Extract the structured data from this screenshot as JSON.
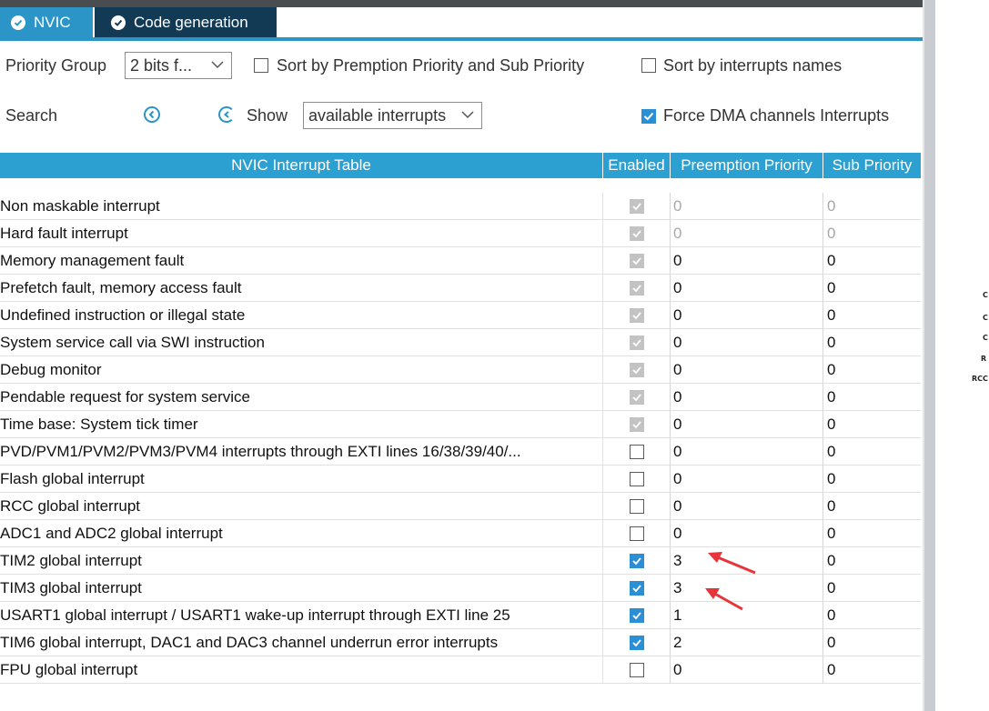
{
  "tabs": [
    {
      "label": "NVIC"
    },
    {
      "label": "Code generation"
    }
  ],
  "controls": {
    "priority_group_label": "Priority Group",
    "priority_group_value": "2 bits f...",
    "sort_priority_label": "Sort by Premption Priority and Sub Priority",
    "sort_names_label": "Sort by interrupts names",
    "search_label": "Search",
    "show_label": "Show",
    "show_value": "available interrupts",
    "force_dma_label": "Force DMA channels Interrupts",
    "force_dma_checked": true
  },
  "table": {
    "headers": [
      "NVIC Interrupt Table",
      "Enabled",
      "Preemption Priority",
      "Sub Priority"
    ],
    "rows": [
      {
        "name": "Non maskable interrupt",
        "enabled": "locked",
        "pre": "0",
        "sub": "0",
        "disabled": true
      },
      {
        "name": "Hard fault interrupt",
        "enabled": "locked",
        "pre": "0",
        "sub": "0",
        "disabled": true
      },
      {
        "name": "Memory management fault",
        "enabled": "locked",
        "pre": "0",
        "sub": "0",
        "disabled": false
      },
      {
        "name": "Prefetch fault, memory access fault",
        "enabled": "locked",
        "pre": "0",
        "sub": "0",
        "disabled": false
      },
      {
        "name": "Undefined instruction or illegal state",
        "enabled": "locked",
        "pre": "0",
        "sub": "0",
        "disabled": false
      },
      {
        "name": "System service call via SWI instruction",
        "enabled": "locked",
        "pre": "0",
        "sub": "0",
        "disabled": false
      },
      {
        "name": "Debug monitor",
        "enabled": "locked",
        "pre": "0",
        "sub": "0",
        "disabled": false
      },
      {
        "name": "Pendable request for system service",
        "enabled": "locked",
        "pre": "0",
        "sub": "0",
        "disabled": false
      },
      {
        "name": "Time base: System tick timer",
        "enabled": "locked",
        "pre": "0",
        "sub": "0",
        "disabled": false
      },
      {
        "name": "PVD/PVM1/PVM2/PVM3/PVM4 interrupts through EXTI lines 16/38/39/40/...",
        "enabled": "off",
        "pre": "0",
        "sub": "0",
        "disabled": false
      },
      {
        "name": "Flash global interrupt",
        "enabled": "off",
        "pre": "0",
        "sub": "0",
        "disabled": false
      },
      {
        "name": "RCC global interrupt",
        "enabled": "off",
        "pre": "0",
        "sub": "0",
        "disabled": false
      },
      {
        "name": "ADC1 and ADC2 global interrupt",
        "enabled": "off",
        "pre": "0",
        "sub": "0",
        "disabled": false
      },
      {
        "name": "TIM2 global interrupt",
        "enabled": "on",
        "pre": "3",
        "sub": "0",
        "disabled": false
      },
      {
        "name": "TIM3 global interrupt",
        "enabled": "on",
        "pre": "3",
        "sub": "0",
        "disabled": false
      },
      {
        "name": "USART1 global interrupt / USART1 wake-up interrupt through EXTI line 25",
        "enabled": "on",
        "pre": "1",
        "sub": "0",
        "disabled": false
      },
      {
        "name": "TIM6 global interrupt, DAC1 and DAC3 channel underrun error interrupts",
        "enabled": "on",
        "pre": "2",
        "sub": "0",
        "disabled": false
      },
      {
        "name": "FPU global interrupt",
        "enabled": "off",
        "pre": "0",
        "sub": "0",
        "disabled": false
      }
    ]
  },
  "side_text": [
    "C",
    "C",
    "C",
    "R",
    "RCC"
  ],
  "colors": {
    "tab_active": "#2b95c7",
    "tab_inactive": "#123a55",
    "header": "#2ba0d1",
    "checkbox_on": "#2b8fd6",
    "arrow": "#e8333a"
  }
}
